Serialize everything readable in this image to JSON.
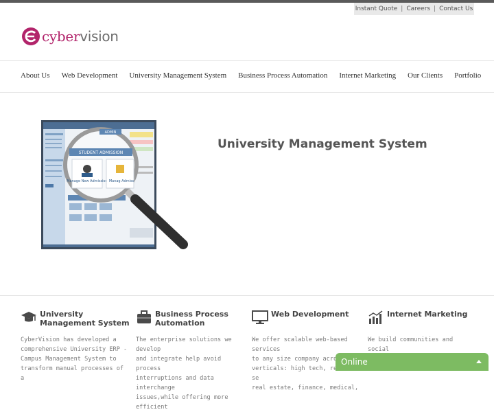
{
  "top_links": [
    "Instant Quote",
    "Careers",
    "Contact Us"
  ],
  "top_separator": "|",
  "logo": {
    "part1": "cyber",
    "part2": "vision"
  },
  "nav": [
    "About Us",
    "Web Development",
    "University Management System",
    "Business Process Automation",
    "Internet Marketing",
    "Our Clients",
    "Portfolio"
  ],
  "hero": {
    "title": "University Management System",
    "screenshot_labels": {
      "banner": "STUDENT ADMISSION",
      "tile1": "Manage New Admission",
      "tile2": "Manag Admiss",
      "admin": "ADMIN"
    }
  },
  "features": [
    {
      "icon": "graduation-cap-icon",
      "title": "University Management System",
      "text": "CyberVision has developed a\ncomprehensive University ERP -\nCampus Management System to\ntransform manual processes of a"
    },
    {
      "icon": "briefcase-icon",
      "title": "Business Process Automation",
      "text": "The enterprise solutions we develop\nand integrate help avoid process\ninterruptions and data interchange\nissues,while offering more efficient"
    },
    {
      "icon": "monitor-icon",
      "title": "Web Development",
      "text": "We offer scalable web-based services\nto any size company across all\nverticals: high tech, retail, se\nreal estate, finance, medical,"
    },
    {
      "icon": "bar-chart-icon",
      "title": "Internet Marketing",
      "text": "We build communities and social\nnetworks, embed social features to"
    }
  ],
  "chat": {
    "label": "Online"
  },
  "colors": {
    "brand": "#b2246b",
    "chat": "#7dbb62",
    "topbar": "#5a5a5a"
  }
}
